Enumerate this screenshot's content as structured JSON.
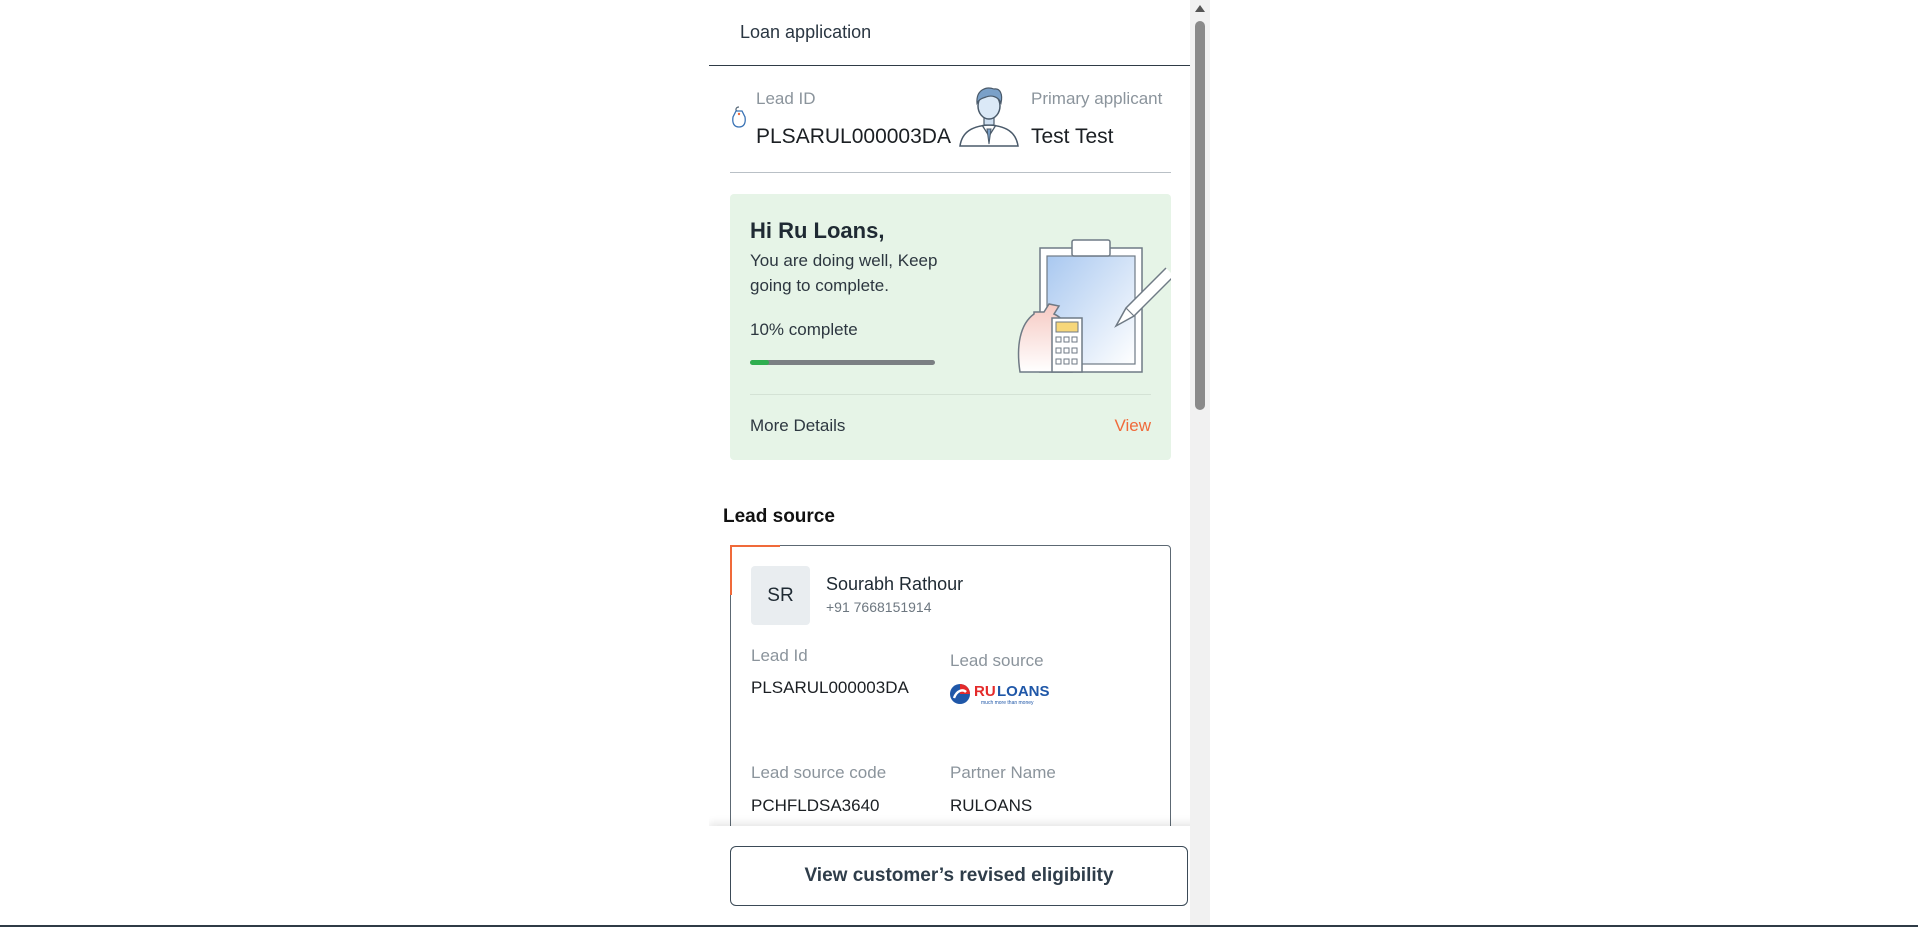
{
  "header": {
    "title": "Loan application"
  },
  "lead": {
    "id_label": "Lead ID",
    "id_value": "PLSARUL000003DA",
    "applicant_label": "Primary applicant",
    "applicant_value": "Test Test"
  },
  "progress_card": {
    "greeting": "Hi Ru Loans,",
    "message": "You are doing well, Keep going to complete.",
    "progress_text": "10% complete",
    "progress_value": 0.1,
    "more_details_label": "More Details",
    "view_label": "View"
  },
  "lead_source": {
    "section_title": "Lead source",
    "initials": "SR",
    "name": "Sourabh Rathour",
    "phone": "+91 7668151914",
    "lead_id_label": "Lead Id",
    "lead_id_value": "PLSARUL000003DA",
    "source_label": "Lead source",
    "source_logo_text": "RULOANS",
    "source_logo_tagline": "much more than money",
    "code_label": "Lead source code",
    "code_value": "PCHFLDSA3640",
    "partner_label": "Partner Name",
    "partner_value": "RULOANS"
  },
  "footer": {
    "eligibility_button": "View customer’s revised eligibility"
  },
  "colors": {
    "accent": "#f06a3a",
    "progress": "#2eae4f",
    "card_bg": "#e6f4e7"
  },
  "icons": [
    "tag-icon",
    "applicant-avatar-icon",
    "loan-illustration",
    "ruloans-logo"
  ]
}
